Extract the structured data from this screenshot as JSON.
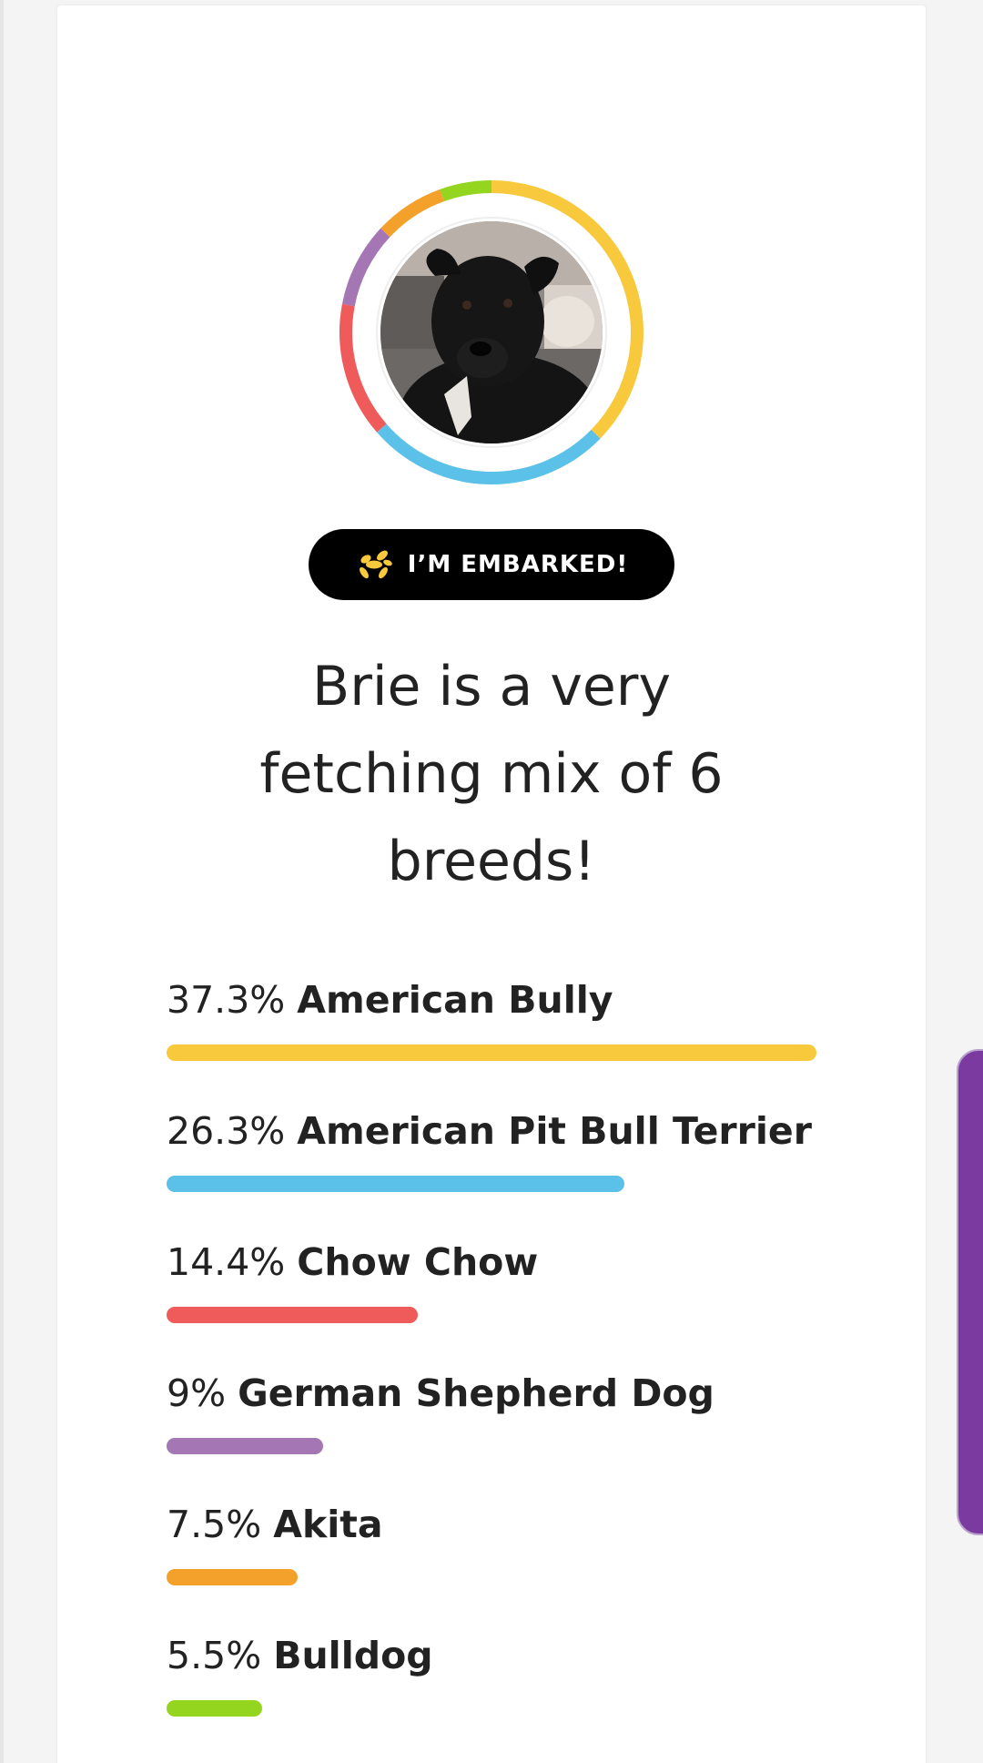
{
  "profile": {
    "badge_label": "I’M EMBARKED!",
    "badge_icon": "balloon-dog-icon",
    "headline_lines": [
      "Brie is a very",
      "fetching mix of 6",
      "breeds!"
    ],
    "photo": "dog-photo"
  },
  "colors": {
    "yellow": "#f8c93d",
    "blue": "#5bc1e8",
    "red": "#ef5b5b",
    "purple": "#a576b4",
    "orange": "#f4a12c",
    "green": "#93d51f",
    "side_tab": "#7a3aa0"
  },
  "breeds": [
    {
      "pct_label": "37.3%",
      "name": "American Bully",
      "pct": 37.3,
      "color": "#f8c93d"
    },
    {
      "pct_label": "26.3%",
      "name": "American Pit Bull Terrier",
      "pct": 26.3,
      "color": "#5bc1e8"
    },
    {
      "pct_label": "14.4%",
      "name": "Chow Chow",
      "pct": 14.4,
      "color": "#ef5b5b"
    },
    {
      "pct_label": "9%",
      "name": "German Shepherd Dog",
      "pct": 9,
      "color": "#a576b4"
    },
    {
      "pct_label": "7.5%",
      "name": "Akita",
      "pct": 7.5,
      "color": "#f4a12c"
    },
    {
      "pct_label": "5.5%",
      "name": "Bulldog",
      "pct": 5.5,
      "color": "#93d51f"
    }
  ]
}
